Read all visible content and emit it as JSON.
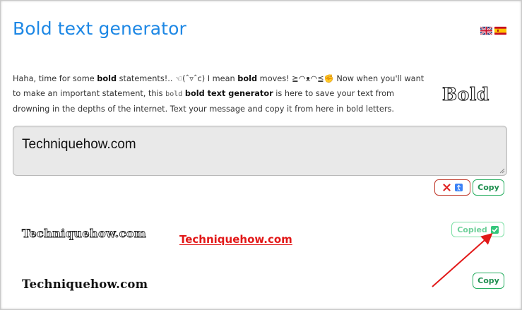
{
  "header": {
    "title": "Bold text generator",
    "languages": [
      {
        "name": "english-flag-icon"
      },
      {
        "name": "spanish-flag-icon"
      }
    ]
  },
  "intro": {
    "p1": "Haha, time for some ",
    "b1": "bold",
    "p2": " statements!.. ☜(ˆ▿ˆc) I mean ",
    "b2": "bold",
    "p3": " moves! ≧◠ᴥ◠≦✊ Now when you'll want to make an important statement, this ",
    "mono": "bold",
    "p4": " ",
    "b3": "bold text generator",
    "p5": " is here to save your text from drowning in the depths of the internet. Text your message and copy it from here in bold letters."
  },
  "logo_text": "Bold",
  "input": {
    "value": "Techniquehow.com"
  },
  "buttons": {
    "copy_label": "Copy",
    "copied_label": "Copied"
  },
  "results": [
    {
      "text": "Techniquehow.com",
      "style": "outline-serif"
    },
    {
      "text": "Techniquehow.com",
      "style": "bold-serif"
    }
  ],
  "annotation": {
    "text": "Techniquehow.com",
    "color": "#e21818"
  },
  "colors": {
    "title": "#1e88e5",
    "copy_green": "#27ae60",
    "copied_green": "#7ee0a6",
    "clear_red": "#c0392b",
    "arrow_red": "#e21818"
  }
}
